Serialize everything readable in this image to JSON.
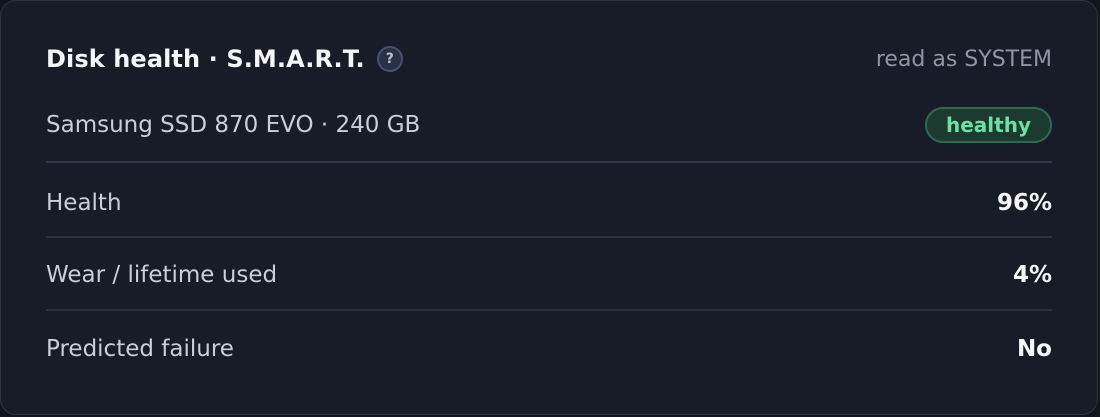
{
  "panel": {
    "title": "Disk health · S.M.A.R.T.",
    "help_icon": "question-mark-icon",
    "help_glyph": "?",
    "read_as": "read as SYSTEM"
  },
  "device": {
    "name": "Samsung SSD 870 EVO · 240 GB",
    "status": "healthy",
    "status_color": "#6ee0a6"
  },
  "metrics": [
    {
      "label": "Health",
      "value": "96%"
    },
    {
      "label": "Wear / lifetime used",
      "value": "4%"
    },
    {
      "label": "Predicted failure",
      "value": "No"
    }
  ],
  "colors": {
    "background": "#181c28",
    "accent_healthy": "#6ee0a6"
  }
}
